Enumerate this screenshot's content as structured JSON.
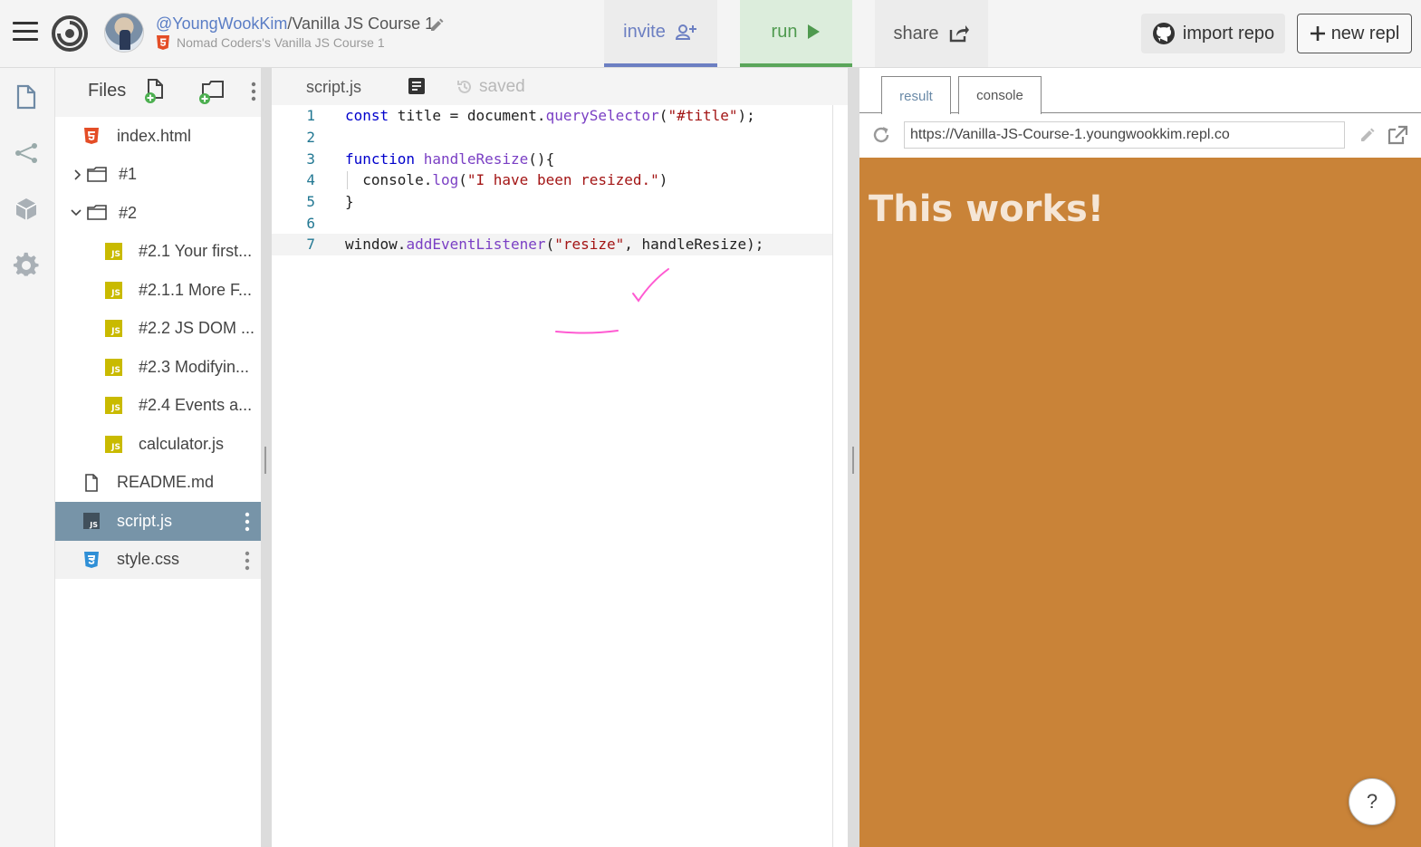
{
  "topbar": {
    "user": "@YoungWookKim",
    "separator": "/",
    "repl_name": "Vanilla JS Course 1",
    "template": "Nomad Coders's Vanilla JS Course 1",
    "invite_label": "invite",
    "run_label": "run",
    "share_label": "share",
    "import_label": "import repo",
    "new_label": "new repl"
  },
  "files": {
    "title": "Files",
    "items": [
      {
        "label": "index.html",
        "type": "html"
      },
      {
        "label": "#1",
        "type": "folder-closed"
      },
      {
        "label": "#2",
        "type": "folder-open"
      },
      {
        "label": "#2.1 Your first...",
        "type": "js"
      },
      {
        "label": "#2.1.1 More F...",
        "type": "js"
      },
      {
        "label": "#2.2 JS DOM ...",
        "type": "js"
      },
      {
        "label": "#2.3 Modifyin...",
        "type": "js"
      },
      {
        "label": "#2.4 Events a...",
        "type": "js"
      },
      {
        "label": "calculator.js",
        "type": "js"
      },
      {
        "label": "README.md",
        "type": "md"
      },
      {
        "label": "script.js",
        "type": "js",
        "active": true
      },
      {
        "label": "style.css",
        "type": "css"
      }
    ]
  },
  "editor": {
    "tab": "script.js",
    "status": "saved",
    "line_numbers": [
      "1",
      "2",
      "3",
      "4",
      "5",
      "6",
      "7"
    ]
  },
  "output": {
    "tab_result": "result",
    "tab_console": "console",
    "url": "https://Vanilla-JS-Course-1.youngwookkim.repl.co",
    "heading": "This works!",
    "background_color": "#c98338",
    "help_label": "?"
  },
  "colors": {
    "accent_invite": "#6c7fc2",
    "accent_run": "#5aa65a",
    "active_file": "#7794a8"
  }
}
